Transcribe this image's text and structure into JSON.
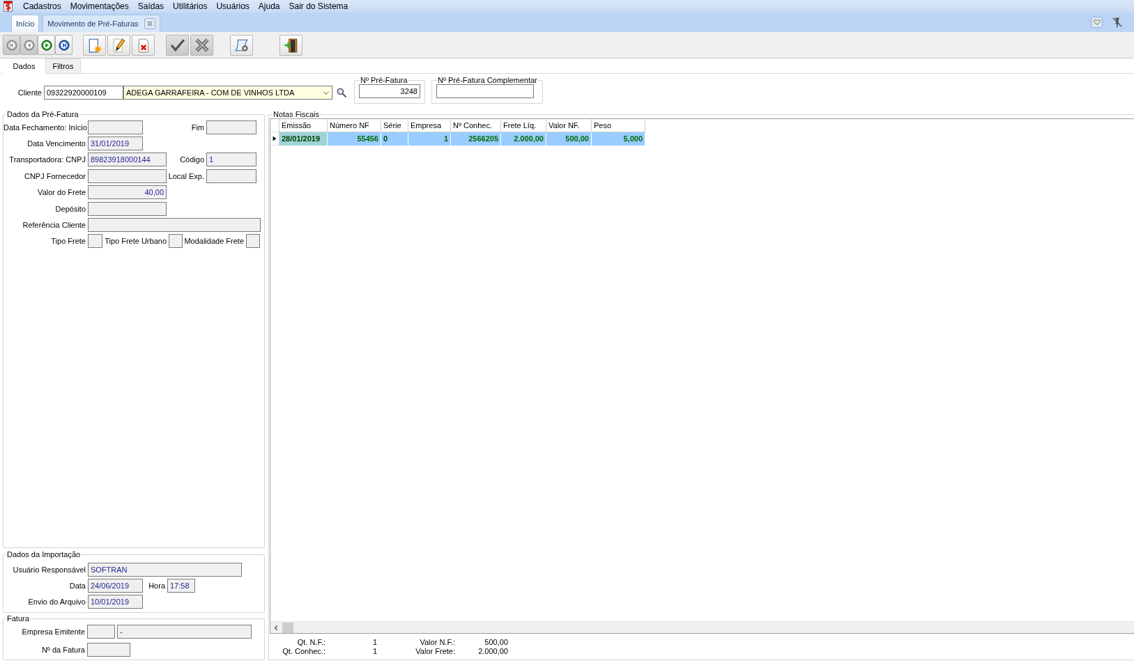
{
  "menu": [
    "Cadastros",
    "Movimentações",
    "Saídas",
    "Utilitários",
    "Usuários",
    "Ajuda",
    "Sair do Sistema"
  ],
  "doc_tabs": [
    {
      "label": "Início",
      "selected": false,
      "closable": false
    },
    {
      "label": "Movimento de Pré-Faturas",
      "selected": true,
      "closable": true
    }
  ],
  "toolbar": [
    [
      {
        "kind": "first",
        "disabled": true
      },
      {
        "kind": "prior",
        "disabled": true
      },
      {
        "kind": "next",
        "disabled": false
      },
      {
        "kind": "last",
        "disabled": false
      }
    ],
    [
      {
        "kind": "new",
        "disabled": false
      },
      {
        "kind": "edit",
        "disabled": false
      },
      {
        "kind": "delete",
        "disabled": false
      }
    ],
    [
      {
        "kind": "confirm",
        "disabled": true
      },
      {
        "kind": "cancel",
        "disabled": true
      }
    ],
    [
      {
        "kind": "report",
        "disabled": false
      }
    ],
    [
      {
        "kind": "exit",
        "disabled": false
      }
    ]
  ],
  "form_tabs": [
    {
      "label": "Dados",
      "selected": true
    },
    {
      "label": "Filtros",
      "selected": false
    }
  ],
  "cliente": {
    "label": "Cliente",
    "code": "09322920000109",
    "name": "ADEGA GARRAFEIRA - COM DE VINHOS LTDA"
  },
  "pre_fatura": {
    "title": "Nº Pré-Fatura",
    "value": "3248"
  },
  "pre_fatura_complementar": {
    "title": "Nº Pré-Fatura Complementar"
  },
  "dados_pre_fatura": {
    "title": "Dados da Pré-Fatura",
    "rows": [
      [
        {
          "label": "Data Fechamento: Início"
        },
        {
          "label": "Fim"
        }
      ],
      [
        {
          "label": "Data Vencimento",
          "value": "31/01/2019"
        }
      ],
      [
        {
          "label": "Transportadora: CNPJ",
          "value": "89823918000144"
        },
        {
          "label": "Código",
          "value": "1"
        }
      ],
      [
        {
          "label": "CNPJ Fornecedor"
        },
        {
          "label": "Local Exp."
        }
      ],
      [
        {
          "label": "Valor do Frete",
          "value": "40,00"
        }
      ],
      [
        {
          "label": "Depósito"
        }
      ],
      [
        {
          "label": "Referência Cliente"
        }
      ],
      [
        {
          "label": "Tipo Frete"
        },
        {
          "label": "Tipo Frete Urbano"
        },
        {
          "label": "Modalidade Frete"
        }
      ]
    ]
  },
  "dados_importacao": {
    "title": "Dados da Importação",
    "rows": [
      [
        {
          "label": "Usuário Responsável",
          "value": "SOFTRAN"
        }
      ],
      [
        {
          "label": "Data",
          "value": "24/06/2019"
        },
        {
          "label": "Hora",
          "value": "17:58"
        }
      ],
      [
        {
          "label": "Envio do Arquivo",
          "value": "10/01/2019"
        }
      ]
    ]
  },
  "fatura": {
    "title": "Fatura",
    "rows": [
      [
        {
          "label": "Empresa Emitente"
        },
        {
          "value": "-"
        }
      ],
      [
        {
          "label": "Nº da Fatura"
        }
      ]
    ]
  },
  "notas_fiscais": {
    "title": "Notas Fiscais",
    "columns": [
      "Emissão",
      "Número NF",
      "Série",
      "Empresa",
      "Nº Conhec.",
      "Frete Líq.",
      "Valor NF.",
      "Peso"
    ],
    "rows": [
      {
        "selected": true,
        "cells": [
          "28/01/2019",
          "55456",
          "0",
          "1",
          "2566205",
          "2.000,00",
          "500,00",
          "5,000"
        ]
      }
    ],
    "totals": [
      {
        "label": "Qt. N.F.:",
        "value": "1"
      },
      {
        "label": "Valor N.F.:",
        "value": "500,00"
      },
      {
        "label": "Qt. Conhec.:",
        "value": "1"
      },
      {
        "label": "Valor Frete:",
        "value": "2.000,00"
      }
    ]
  }
}
